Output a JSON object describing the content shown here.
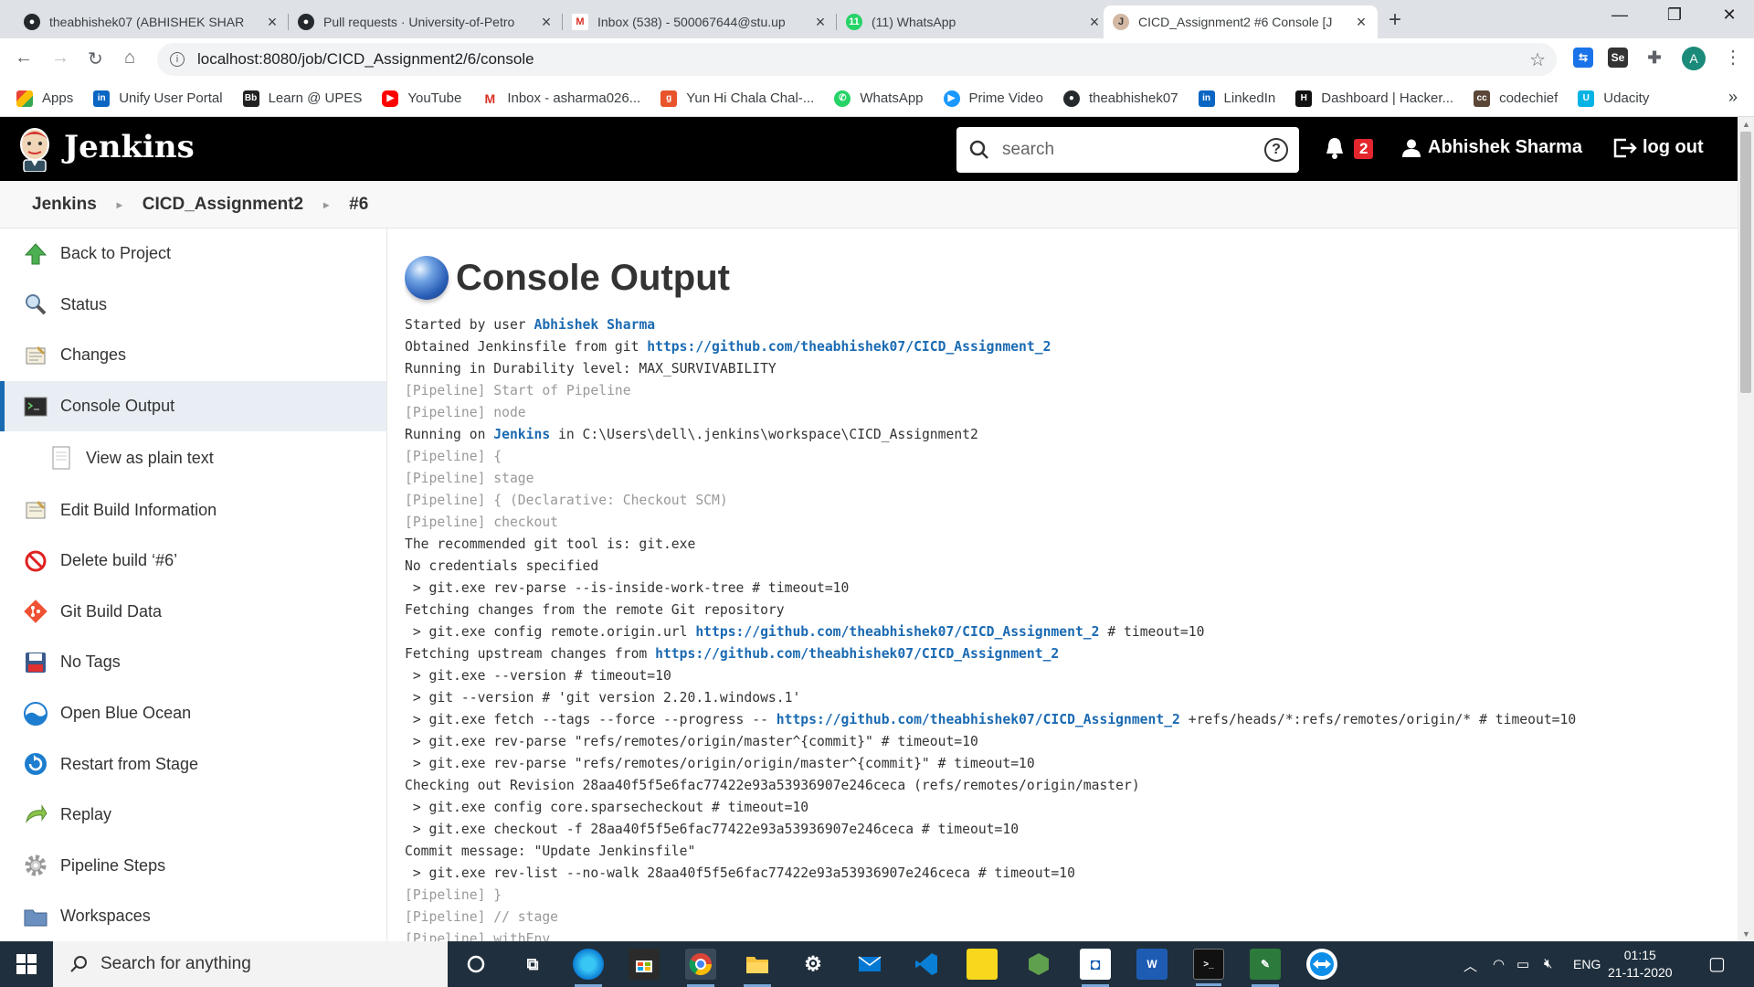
{
  "browser": {
    "tabs": [
      {
        "title": "theabhishek07 (ABHISHEK SHAR",
        "icon": "github-icon"
      },
      {
        "title": "Pull requests · University-of-Petro",
        "icon": "github-icon"
      },
      {
        "title": "Inbox (538) - 500067644@stu.up",
        "icon": "gmail-icon"
      },
      {
        "title": "(11) WhatsApp",
        "icon": "whatsapp-icon"
      },
      {
        "title": "CICD_Assignment2 #6 Console [J",
        "icon": "jenkins-icon"
      }
    ],
    "url": "localhost:8080/job/CICD_Assignment2/6/console",
    "profile_initial": "A",
    "bookmarks": [
      {
        "label": "Apps",
        "icon": "apps-grid-icon",
        "color": "#4285f4"
      },
      {
        "label": "Unify User Portal",
        "icon": "linkedin-like-icon",
        "color": "#0a66c2"
      },
      {
        "label": "Learn @ UPES",
        "icon": "bb-icon",
        "color": "#222222"
      },
      {
        "label": "YouTube",
        "icon": "youtube-icon",
        "color": "#ff0000"
      },
      {
        "label": "Inbox - asharma026...",
        "icon": "gmail-icon",
        "color": "#d93025"
      },
      {
        "label": "Yun Hi Chala Chal-...",
        "icon": "genius-icon",
        "color": "#e8542c"
      },
      {
        "label": "WhatsApp",
        "icon": "whatsapp-icon",
        "color": "#25d366"
      },
      {
        "label": "Prime Video",
        "icon": "prime-video-icon",
        "color": "#1a98ff"
      },
      {
        "label": "theabhishek07",
        "icon": "github-icon",
        "color": "#24292e"
      },
      {
        "label": "LinkedIn",
        "icon": "linkedin-icon",
        "color": "#0a66c2"
      },
      {
        "label": "Dashboard | Hacker...",
        "icon": "hackerrank-icon",
        "color": "#111111"
      },
      {
        "label": "codechief",
        "icon": "codechef-icon",
        "color": "#5b4638"
      },
      {
        "label": "Udacity",
        "icon": "udacity-icon",
        "color": "#02b3e4"
      }
    ]
  },
  "jenkins": {
    "title": "Jenkins",
    "search_placeholder": "search",
    "notifications": "2",
    "user": "Abhishek Sharma",
    "logout": "log out",
    "breadcrumb": [
      "Jenkins",
      "CICD_Assignment2",
      "#6"
    ]
  },
  "sidebar": {
    "items": [
      {
        "label": "Back to Project",
        "icon": "up-arrow-icon"
      },
      {
        "label": "Status",
        "icon": "magnifier-icon"
      },
      {
        "label": "Changes",
        "icon": "notepad-icon"
      },
      {
        "label": "Console Output",
        "icon": "terminal-icon"
      },
      {
        "label": "View as plain text",
        "icon": "document-icon"
      },
      {
        "label": "Edit Build Information",
        "icon": "notepad-edit-icon"
      },
      {
        "label": "Delete build ‘#6’",
        "icon": "no-entry-icon"
      },
      {
        "label": "Git Build Data",
        "icon": "git-icon"
      },
      {
        "label": "No Tags",
        "icon": "floppy-disk-icon"
      },
      {
        "label": "Open Blue Ocean",
        "icon": "blue-ocean-icon"
      },
      {
        "label": "Restart from Stage",
        "icon": "restart-icon"
      },
      {
        "label": "Replay",
        "icon": "replay-icon"
      },
      {
        "label": "Pipeline Steps",
        "icon": "gear-icon"
      },
      {
        "label": "Workspaces",
        "icon": "folder-icon"
      }
    ]
  },
  "console": {
    "title": "Console Output",
    "lines": [
      [
        {
          "t": "Started by user "
        },
        {
          "t": "Abhishek Sharma",
          "c": "lnk"
        }
      ],
      [
        {
          "t": "Obtained Jenkinsfile from git "
        },
        {
          "t": "https://github.com/theabhishek07/CICD_Assignment_2",
          "c": "lnk"
        }
      ],
      [
        {
          "t": "Running in Durability level: MAX_SURVIVABILITY"
        }
      ],
      [
        {
          "t": "[Pipeline] Start of Pipeline",
          "c": "pl"
        }
      ],
      [
        {
          "t": "[Pipeline] node",
          "c": "pl"
        }
      ],
      [
        {
          "t": "Running on "
        },
        {
          "t": "Jenkins",
          "c": "lnk"
        },
        {
          "t": " in C:\\Users\\dell\\.jenkins\\workspace\\CICD_Assignment2"
        }
      ],
      [
        {
          "t": "[Pipeline] {",
          "c": "pl"
        }
      ],
      [
        {
          "t": "[Pipeline] stage",
          "c": "pl"
        }
      ],
      [
        {
          "t": "[Pipeline] { (Declarative: Checkout SCM)",
          "c": "pl"
        }
      ],
      [
        {
          "t": "[Pipeline] checkout",
          "c": "pl"
        }
      ],
      [
        {
          "t": "The recommended git tool is: git.exe"
        }
      ],
      [
        {
          "t": "No credentials specified"
        }
      ],
      [
        {
          "t": " > git.exe rev-parse --is-inside-work-tree # timeout=10"
        }
      ],
      [
        {
          "t": "Fetching changes from the remote Git repository"
        }
      ],
      [
        {
          "t": " > git.exe config remote.origin.url "
        },
        {
          "t": "https://github.com/theabhishek07/CICD_Assignment_2",
          "c": "lnk"
        },
        {
          "t": " # timeout=10"
        }
      ],
      [
        {
          "t": "Fetching upstream changes from "
        },
        {
          "t": "https://github.com/theabhishek07/CICD_Assignment_2",
          "c": "lnk"
        }
      ],
      [
        {
          "t": " > git.exe --version # timeout=10"
        }
      ],
      [
        {
          "t": " > git --version # 'git version 2.20.1.windows.1'"
        }
      ],
      [
        {
          "t": " > git.exe fetch --tags --force --progress -- "
        },
        {
          "t": "https://github.com/theabhishek07/CICD_Assignment_2",
          "c": "lnk"
        },
        {
          "t": " +refs/heads/*:refs/remotes/origin/* # timeout=10"
        }
      ],
      [
        {
          "t": " > git.exe rev-parse \"refs/remotes/origin/master^{commit}\" # timeout=10"
        }
      ],
      [
        {
          "t": " > git.exe rev-parse \"refs/remotes/origin/origin/master^{commit}\" # timeout=10"
        }
      ],
      [
        {
          "t": "Checking out Revision 28aa40f5f5e6fac77422e93a53936907e246ceca (refs/remotes/origin/master)"
        }
      ],
      [
        {
          "t": " > git.exe config core.sparsecheckout # timeout=10"
        }
      ],
      [
        {
          "t": " > git.exe checkout -f 28aa40f5f5e6fac77422e93a53936907e246ceca # timeout=10"
        }
      ],
      [
        {
          "t": "Commit message: \"Update Jenkinsfile\""
        }
      ],
      [
        {
          "t": " > git.exe rev-list --no-walk 28aa40f5f5e6fac77422e93a53936907e246ceca # timeout=10"
        }
      ],
      [
        {
          "t": "[Pipeline] }",
          "c": "pl"
        }
      ],
      [
        {
          "t": "[Pipeline] // stage",
          "c": "pl"
        }
      ],
      [
        {
          "t": "[Pipeline] withEnv",
          "c": "pl"
        }
      ]
    ]
  },
  "taskbar": {
    "search_placeholder": "Search for anything",
    "language": "ENG",
    "time": "01:15",
    "date": "21-11-2020"
  }
}
